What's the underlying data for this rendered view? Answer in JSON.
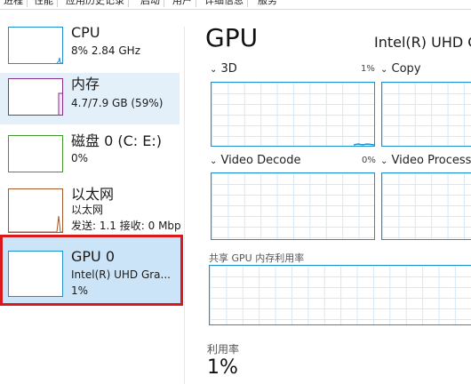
{
  "tabs": [
    "进程",
    "性能",
    "应用历史记录",
    "启动",
    "用户",
    "详细信息",
    "服务"
  ],
  "sidebar": {
    "cpu": {
      "name": "CPU",
      "detail": "8%  2.84 GHz"
    },
    "memory": {
      "name": "内存",
      "detail": "4.7/7.9 GB (59%)"
    },
    "disk": {
      "name": "磁盘 0 (C: E:)",
      "detail": "0%"
    },
    "ethernet": {
      "name": "以太网",
      "detail1": "以太网",
      "detail2": "发送: 1.1  接收: 0 Mbp"
    },
    "gpu": {
      "name": "GPU 0",
      "detail1": "Intel(R) UHD Gra...",
      "detail2": "1%"
    }
  },
  "main": {
    "title": "GPU",
    "device": "Intel(R) UHD G",
    "engines": [
      {
        "label": "3D",
        "percent": "1%"
      },
      {
        "label": "Copy",
        "percent": ""
      },
      {
        "label": "Video Decode",
        "percent": "0%"
      },
      {
        "label": "Video Processi",
        "percent": ""
      }
    ],
    "shared_memory_label": "共享 GPU 内存利用率",
    "utilization_label": "利用率",
    "utilization_value": "1%"
  }
}
